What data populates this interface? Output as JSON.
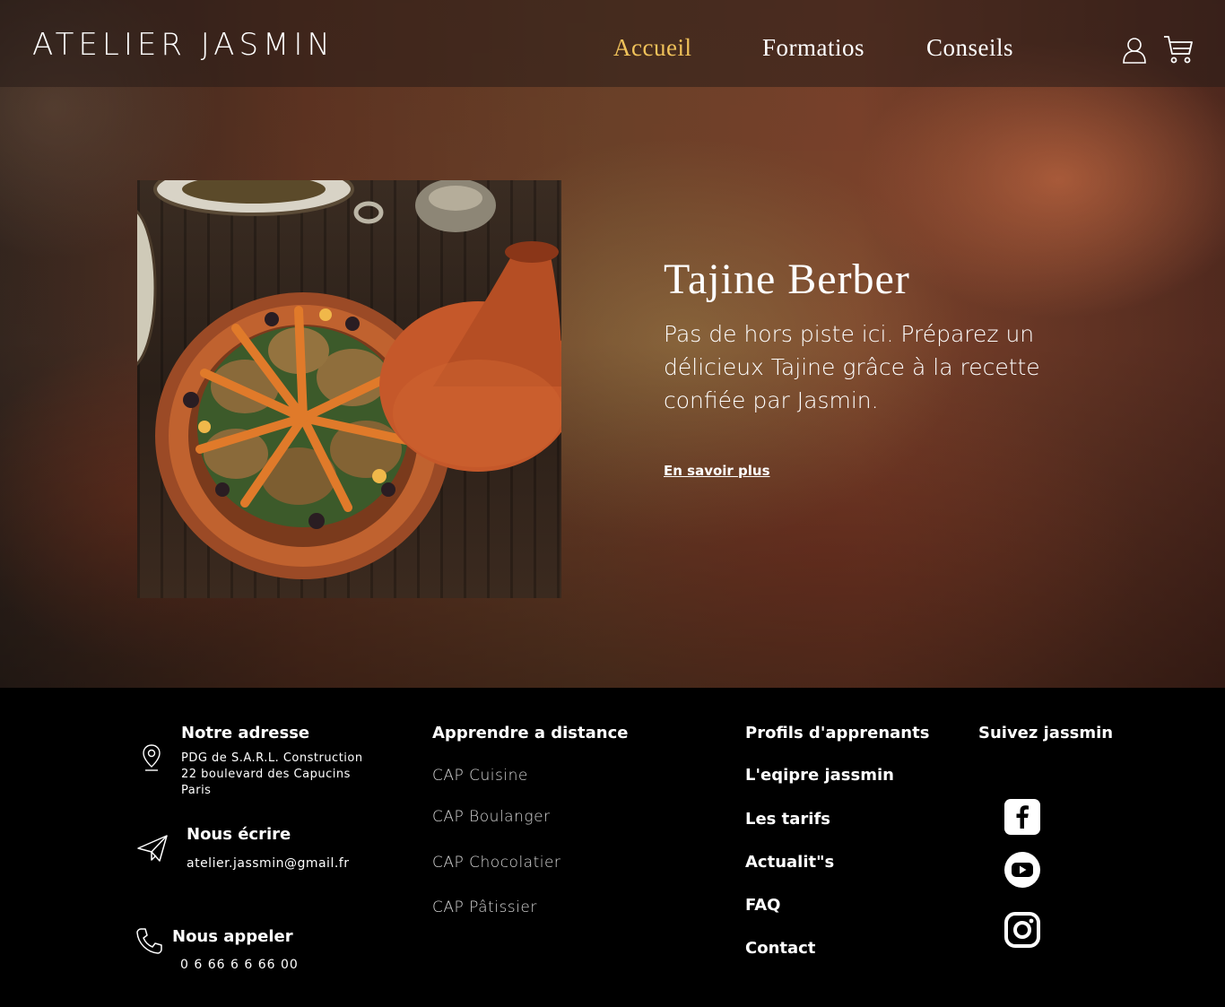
{
  "header": {
    "logo_text": "ATELIER JASMIN",
    "nav": [
      {
        "label": "Accueil",
        "active": true
      },
      {
        "label": "Formatios",
        "active": false
      },
      {
        "label": "Conseils",
        "active": false
      }
    ],
    "icons": [
      "user-icon",
      "cart-icon"
    ],
    "active_color": "#f0c25a"
  },
  "hero": {
    "title": "Tajine Berber",
    "description": "Pas de hors piste ici. Préparez un délicieux Tajine grâce à la recette confiée par Jasmin.",
    "link_label": "En savoir plus"
  },
  "footer": {
    "address": {
      "heading": "Notre adresse",
      "lines": [
        "PDG de S.A.R.L. Construction",
        "22 boulevard des Capucins",
        "Paris"
      ],
      "icon": "location-pin-icon"
    },
    "write": {
      "heading": "Nous écrire",
      "email": "atelier.jassmin@gmail.fr",
      "icon": "paper-plane-icon"
    },
    "call": {
      "heading": "Nous appeler",
      "phone": "0 6 66 6 6 66 00",
      "icon": "phone-icon"
    },
    "learn": {
      "heading": "Apprendre a distance",
      "links": [
        "CAP Cuisine",
        "CAP Boulanger",
        "CAP Chocolatier",
        "CAP Pâtissier"
      ]
    },
    "about_links": [
      "Profils d'apprenants",
      "L'eqipre jassmin",
      "Les tarifs",
      "Actualit\"s",
      "FAQ",
      "Contact"
    ],
    "social": {
      "heading": "Suivez jassmin",
      "icons": [
        "facebook-icon",
        "youtube-icon",
        "instagram-icon"
      ]
    }
  }
}
